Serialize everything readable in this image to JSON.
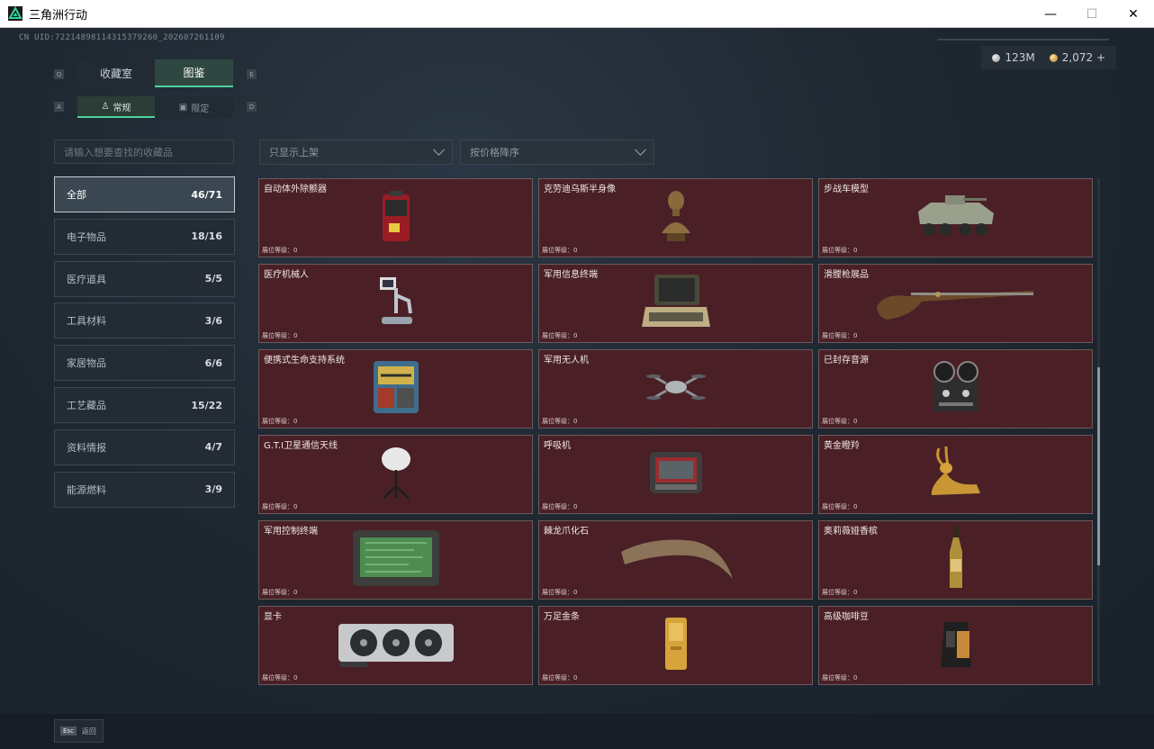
{
  "window": {
    "title": "三角洲行动",
    "minimize": "—",
    "maximize": "☐",
    "close": "✕"
  },
  "uid": "CN UID:722148981143153792­60_202607261109",
  "currency": {
    "silver": "123M",
    "gold": "2,072",
    "add": "+"
  },
  "tabs": {
    "q_key": "Q",
    "e_key": "E",
    "main": [
      {
        "label": "收藏室"
      },
      {
        "label": "图鉴"
      }
    ]
  },
  "subtabs": {
    "a_key": "A",
    "d_key": "D",
    "items": [
      {
        "label": "常规"
      },
      {
        "label": "限定"
      }
    ]
  },
  "search": {
    "placeholder": "请输入想要查找的收藏品"
  },
  "filters": {
    "shelf": "只显示上架",
    "sort": "按价格降序"
  },
  "categories": [
    {
      "label": "全部",
      "count": "46/71"
    },
    {
      "label": "电子物品",
      "count": "18/16"
    },
    {
      "label": "医疗道具",
      "count": "5/5"
    },
    {
      "label": "工具材料",
      "count": "3/6"
    },
    {
      "label": "家居物品",
      "count": "6/6"
    },
    {
      "label": "工艺藏品",
      "count": "15/22"
    },
    {
      "label": "资料情报",
      "count": "4/7"
    },
    {
      "label": "能源燃料",
      "count": "3/9"
    }
  ],
  "level_text": "展位等级：0",
  "items": [
    {
      "name": "自动体外除颤器",
      "icon": "defibrillator-icon"
    },
    {
      "name": "克劳迪乌斯半身像",
      "icon": "bust-icon"
    },
    {
      "name": "步战车模型",
      "icon": "ifv-model-icon"
    },
    {
      "name": "医疗机械人",
      "icon": "medical-robot-icon"
    },
    {
      "name": "军用信息终端",
      "icon": "military-terminal-icon"
    },
    {
      "name": "滑膛枪展品",
      "icon": "musket-icon"
    },
    {
      "name": "便携式生命支持系统",
      "icon": "life-support-icon"
    },
    {
      "name": "军用无人机",
      "icon": "drone-icon"
    },
    {
      "name": "已封存音源",
      "icon": "reel-recorder-icon"
    },
    {
      "name": "G.T.I卫星通信天线",
      "icon": "satellite-dish-icon"
    },
    {
      "name": "呼吸机",
      "icon": "ventilator-icon"
    },
    {
      "name": "黄金瞪羚",
      "icon": "golden-gazelle-icon"
    },
    {
      "name": "军用控制终端",
      "icon": "control-terminal-icon"
    },
    {
      "name": "棘龙爪化石",
      "icon": "claw-fossil-icon"
    },
    {
      "name": "奥莉薇娅香槟",
      "icon": "champagne-icon"
    },
    {
      "name": "显卡",
      "icon": "graphics-card-icon"
    },
    {
      "name": "万足金条",
      "icon": "gold-bar-icon"
    },
    {
      "name": "高级咖啡豆",
      "icon": "coffee-bag-icon"
    }
  ],
  "footer": {
    "esc_key": "Esc",
    "back_label": "返回"
  }
}
